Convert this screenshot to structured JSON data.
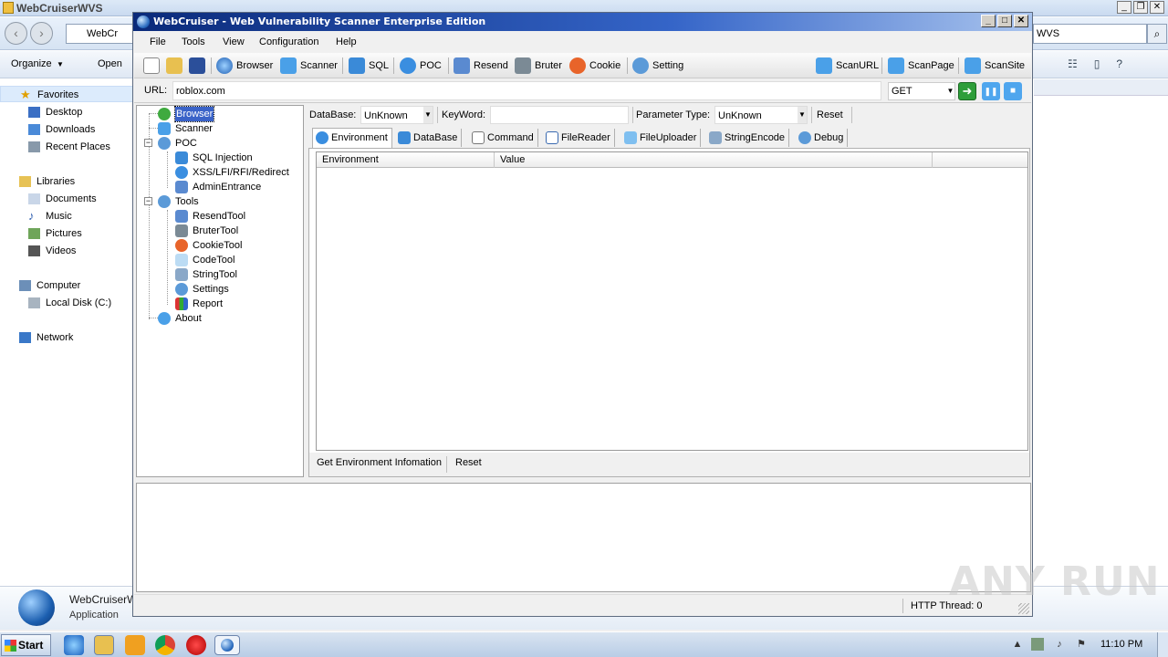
{
  "explorer": {
    "title": "WebCruiserWVS",
    "address": "WebCr",
    "search": "WVS",
    "commands": [
      "Organize",
      "Open"
    ],
    "nav": {
      "favorites": "Favorites",
      "desktop": "Desktop",
      "downloads": "Downloads",
      "recent": "Recent Places",
      "libraries": "Libraries",
      "documents": "Documents",
      "music": "Music",
      "pictures": "Pictures",
      "videos": "Videos",
      "computer": "Computer",
      "local_disk": "Local Disk (C:)",
      "network": "Network"
    },
    "details": {
      "name": "WebCruiserW",
      "type": "Application"
    }
  },
  "window": {
    "title": "WebCruiser - Web Vulnerability Scanner Enterprise Edition",
    "menu": [
      "File",
      "Tools",
      "View",
      "Configuration",
      "Help"
    ],
    "toolbar": {
      "browser": "Browser",
      "scanner": "Scanner",
      "sql": "SQL",
      "poc": "POC",
      "resend": "Resend",
      "bruter": "Bruter",
      "cookie": "Cookie",
      "setting": "Setting",
      "scan_url": "ScanURL",
      "scan_page": "ScanPage",
      "scan_site": "ScanSite"
    },
    "url": {
      "label": "URL:",
      "value": "roblox.com",
      "method": "GET"
    }
  },
  "tree": {
    "browser": "Browser",
    "scanner": "Scanner",
    "poc": "POC",
    "sql_injection": "SQL Injection",
    "xss": "XSS/LFI/RFI/Redirect",
    "admin_entrance": "AdminEntrance",
    "tools": "Tools",
    "resend_tool": "ResendTool",
    "bruter_tool": "BruterTool",
    "cookie_tool": "CookieTool",
    "code_tool": "CodeTool",
    "string_tool": "StringTool",
    "settings": "Settings",
    "report": "Report",
    "about": "About"
  },
  "panel": {
    "database_label": "DataBase:",
    "database_value": "UnKnown",
    "keyword_label": "KeyWord:",
    "keyword_value": "",
    "param_type_label": "Parameter Type:",
    "param_type_value": "UnKnown",
    "reset": "Reset",
    "tabs": [
      "Environment",
      "DataBase",
      "Command",
      "FileReader",
      "FileUploader",
      "StringEncode",
      "Debug"
    ],
    "grid_headers": [
      "Environment",
      "Value",
      ""
    ],
    "get_env": "Get Environment Infomation",
    "reset2": "Reset"
  },
  "status": {
    "http_thread": "HTTP Thread: 0"
  },
  "watermark": "ANY RUN",
  "taskbar": {
    "start": "Start",
    "clock": "11:10 PM"
  }
}
